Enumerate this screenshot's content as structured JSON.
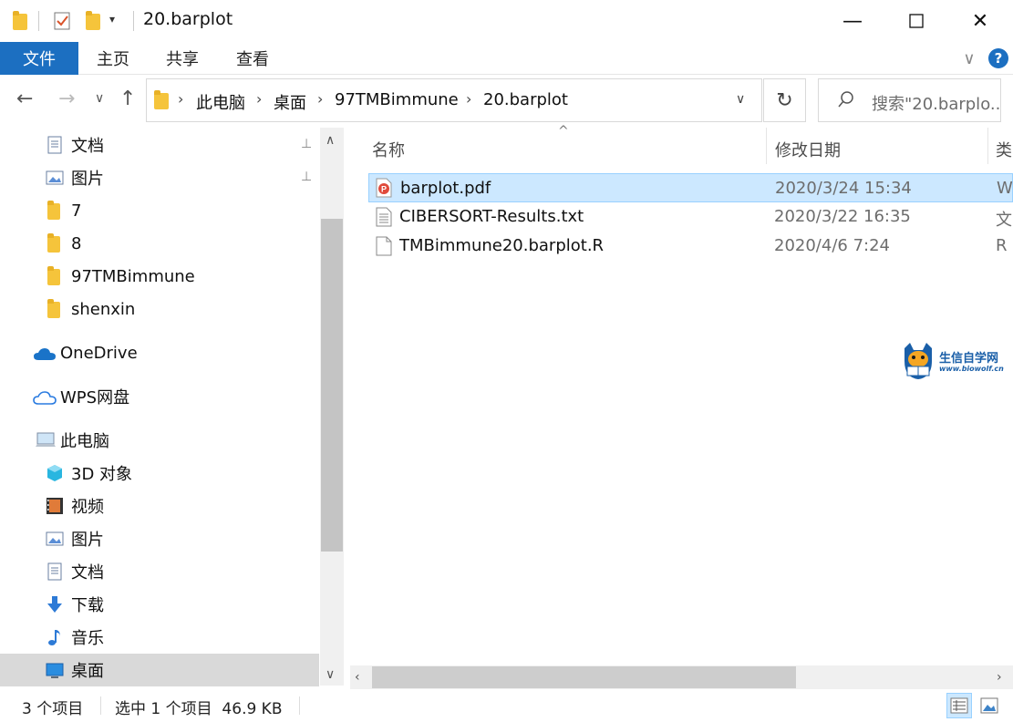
{
  "window": {
    "title": "20.barplot",
    "minimize_glyph": "—",
    "maximize_glyph": "☐",
    "close_glyph": "✕"
  },
  "ribbon": {
    "tabs": [
      {
        "label": "文件",
        "active": true
      },
      {
        "label": "主页"
      },
      {
        "label": "共享"
      },
      {
        "label": "查看"
      }
    ],
    "expand_glyph": "∨",
    "help_glyph": "?"
  },
  "address": {
    "back_glyph": "←",
    "forward_glyph": "→",
    "recent_glyph": "∨",
    "up_glyph": "↑",
    "breadcrumbs": [
      "此电脑",
      "桌面",
      "97TMBimmune",
      "20.barplot"
    ],
    "dropdown_glyph": "∨",
    "refresh_glyph": "↻"
  },
  "search": {
    "placeholder": "搜索\"20.barplo...",
    "icon": "search-icon"
  },
  "nav": {
    "quick_access": [
      {
        "label": "文档",
        "icon": "documents-icon",
        "pinned": true
      },
      {
        "label": "图片",
        "icon": "pictures-icon",
        "pinned": true
      },
      {
        "label": "7",
        "icon": "folder-icon"
      },
      {
        "label": "8",
        "icon": "folder-icon"
      },
      {
        "label": "97TMBimmune",
        "icon": "folder-icon"
      },
      {
        "label": "shenxin",
        "icon": "folder-icon"
      }
    ],
    "onedrive": {
      "label": "OneDrive",
      "icon": "onedrive-icon"
    },
    "wps": {
      "label": "WPS网盘",
      "icon": "cloud-icon"
    },
    "this_pc": {
      "label": "此电脑",
      "icon": "computer-icon"
    },
    "pc_items": [
      {
        "label": "3D 对象",
        "icon": "3d-objects-icon"
      },
      {
        "label": "视频",
        "icon": "videos-icon"
      },
      {
        "label": "图片",
        "icon": "pictures-icon"
      },
      {
        "label": "文档",
        "icon": "documents-icon"
      },
      {
        "label": "下载",
        "icon": "downloads-icon"
      },
      {
        "label": "音乐",
        "icon": "music-icon"
      },
      {
        "label": "桌面",
        "icon": "desktop-icon",
        "selected": true
      }
    ],
    "pin_glyph": "📌"
  },
  "filelist": {
    "columns": [
      "名称",
      "修改日期",
      "类"
    ],
    "sort_glyph": "^",
    "files": [
      {
        "name": "barplot.pdf",
        "date": "2020/3/24 15:34",
        "type": "W",
        "icon": "pdf-icon",
        "selected": true
      },
      {
        "name": "CIBERSORT-Results.txt",
        "date": "2020/3/22 16:35",
        "type": "文",
        "icon": "text-file-icon"
      },
      {
        "name": "TMBimmune20.barplot.R",
        "date": "2020/4/6 7:24",
        "type": "R",
        "icon": "file-icon"
      }
    ]
  },
  "watermark": {
    "title": "生信自学网",
    "url": "www.biowolf.cn"
  },
  "status": {
    "item_count": "3 个项目",
    "selection": "选中 1 个项目  46.9 KB"
  },
  "colors": {
    "file_tab": "#1c6fc1",
    "selection": "#cce8ff",
    "folder": "#f5c43b"
  }
}
